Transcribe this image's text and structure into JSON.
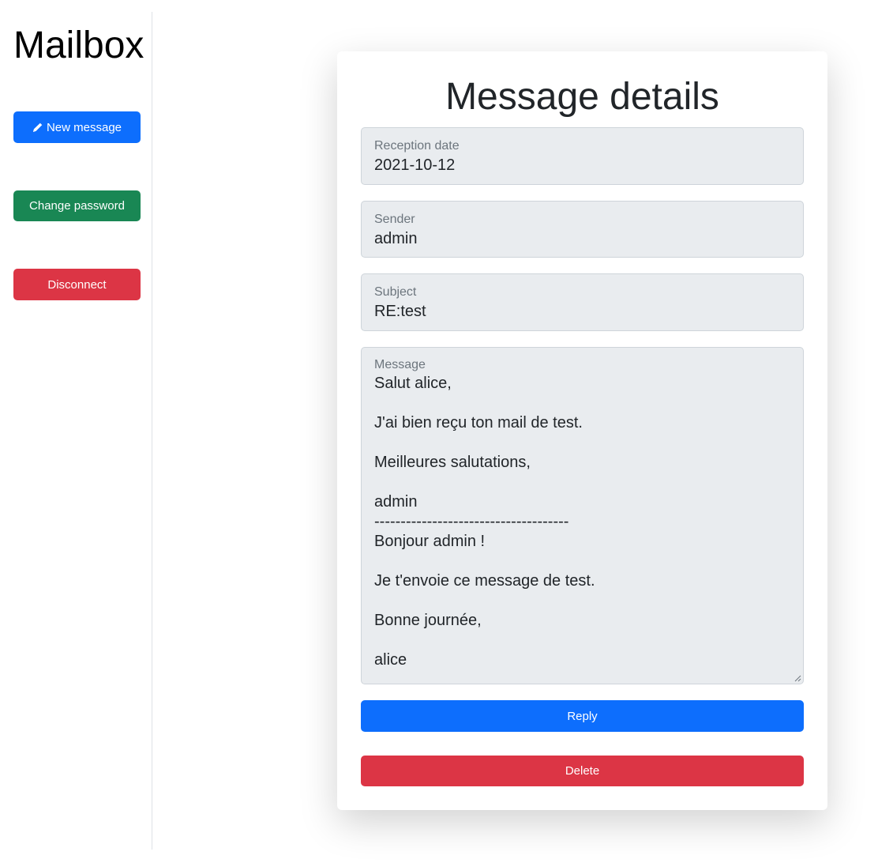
{
  "sidebar": {
    "brand": "Mailbox",
    "new_message_label": "New message",
    "new_message_icon": "pencil-icon",
    "change_password_label": "Change password",
    "disconnect_label": "Disconnect"
  },
  "message": {
    "title": "Message details",
    "reception_date_label": "Reception date",
    "reception_date": "2021-10-12",
    "sender_label": "Sender",
    "sender": "admin",
    "subject_label": "Subject",
    "subject": "RE:test",
    "message_label": "Message",
    "body": "Salut alice,\n\nJ'ai bien reçu ton mail de test.\n\nMeilleures salutations,\n\nadmin\n-------------------------------------\nBonjour admin !\n\nJe t'envoie ce message de test.\n\nBonne journée,\n\nalice",
    "reply_label": "Reply",
    "delete_label": "Delete"
  },
  "colors": {
    "primary": "#0d6efd",
    "success": "#198754",
    "danger": "#dc3545",
    "field_background": "#e9ecef"
  }
}
